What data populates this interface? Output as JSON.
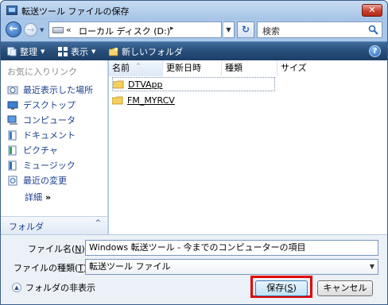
{
  "window": {
    "title": "転送ツール ファイルの保存",
    "close_label": "✕"
  },
  "address": {
    "path": "ローカル ディスク (D:)",
    "separator": "«",
    "arrow": "▸",
    "search_placeholder": "検索"
  },
  "toolbar": {
    "organize": "整理",
    "views": "表示",
    "new_folder": "新しいフォルダ",
    "help": "?"
  },
  "leftnav": {
    "favorites_label": "お気に入りリンク",
    "items": [
      {
        "label": "最近表示した場所",
        "icon": "recent-places-icon"
      },
      {
        "label": "デスクトップ",
        "icon": "desktop-icon"
      },
      {
        "label": "コンピュータ",
        "icon": "computer-icon"
      },
      {
        "label": "ドキュメント",
        "icon": "documents-icon"
      },
      {
        "label": "ピクチャ",
        "icon": "pictures-icon"
      },
      {
        "label": "ミュージック",
        "icon": "music-icon"
      },
      {
        "label": "最近の変更",
        "icon": "recent-changes-icon"
      }
    ],
    "details_label": "詳細",
    "details_chevron": "»",
    "folders_label": "フォルダ",
    "folders_chevron": "^"
  },
  "filelist": {
    "columns": [
      "名前",
      "更新日時",
      "種類",
      "サイズ"
    ],
    "sort_indicator": "^",
    "rows": [
      {
        "name": "DTVApp",
        "selected": true
      },
      {
        "name": "FM_MYRCV",
        "selected": false
      }
    ]
  },
  "form": {
    "filename_label": "ファイル名(",
    "filename_accel": "N",
    "filename_label_end": "):",
    "filename_value": "Windows 転送ツール - 今までのコンピューターの項目",
    "filetype_label": "ファイルの種類(",
    "filetype_accel": "T",
    "filetype_label_end": "):",
    "filetype_value": "転送ツール ファイル",
    "hide_folders": "フォルダの非表示",
    "save_label": "保存(",
    "save_accel": "S",
    "save_label_end": ")",
    "cancel_label": "キャンセル"
  },
  "colors": {
    "highlight_box": "#e00000",
    "toolbar_bg": "#274d7a",
    "link_text": "#1a3f8f"
  }
}
